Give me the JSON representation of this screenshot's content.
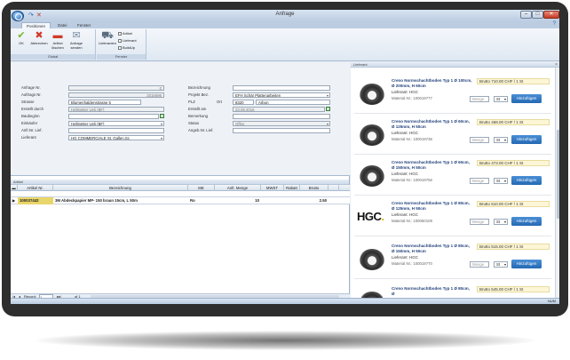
{
  "window": {
    "title": "Anfrage",
    "minimize": "–",
    "maximize": "□",
    "close": "✕"
  },
  "quick_access": {
    "redo": "↷",
    "close_x": "✕"
  },
  "tabs": [
    {
      "label": "Positionen",
      "active": true
    },
    {
      "label": "Datei"
    },
    {
      "label": "Fenster"
    }
  ],
  "ribbon": {
    "groups": [
      {
        "label": "Global"
      },
      {
        "label": "Fenster"
      }
    ],
    "buttons": {
      "ok": "OK",
      "cancel": "Abbrechen",
      "delete": "Artikel löschen",
      "send": "Anfrage senden",
      "supplier": "Lieferanten"
    },
    "options": {
      "artikel": "Artikel",
      "lieferant": "Lieferant",
      "buildup": "BuildUp"
    }
  },
  "form": {
    "left": [
      {
        "label": "Anfrage Nr.",
        "value": "0",
        "disabled": true
      },
      {
        "label": "Auftrags Nr.",
        "value": "2016696",
        "disabled": true
      },
      {
        "label": "Strasse",
        "value": "Blumenhaldenstrasse 5"
      },
      {
        "label": "Erstellt durch",
        "value": "Hellstetter Ueli (BF)",
        "disabled": true
      },
      {
        "label": "Baubeginn",
        "value": ""
      },
      {
        "label": "Einkäufer",
        "value": "Hellstetter Ueli (BF)"
      },
      {
        "label": "Anfr.Nr. Lief.",
        "value": ""
      },
      {
        "label": "Lieferant",
        "value": "HG COMMERCIALE St. Gallen,Sc"
      }
    ],
    "right": [
      {
        "label": "Bezeichnung",
        "value": ""
      },
      {
        "label": "Projekt Bez.",
        "value": "EFH Schär Plattenarbeiten",
        "disabled": true
      },
      {
        "label": "PLZ",
        "label2": "Ort",
        "value": "8320",
        "value2": "Arbon"
      },
      {
        "label": "Erstellt am",
        "value": "23.09.2016",
        "disabled": true
      },
      {
        "label": "Bemerkung",
        "value": ""
      },
      {
        "label": "Status",
        "value": "Offen",
        "disabled": true
      },
      {
        "label": "Angeb.Nr. Lief.",
        "value": ""
      }
    ]
  },
  "grid": {
    "section_label": "Artikel",
    "columns": [
      "Artikel Nr.",
      "Bezeichnung",
      "ME",
      "Anfr. Menge",
      "MWST",
      "Rabatt",
      "Brutto"
    ],
    "rows": [
      {
        "artikel_nr": "100037442",
        "bezeichnung": "3M Abdeckpapier MP- 150 braun 15cm, L 50m",
        "me": "Ro",
        "menge": "10",
        "mwst": "",
        "rabatt": "",
        "brutto": "2.50"
      }
    ],
    "nav": {
      "record_label": "Record:",
      "record_value": "1",
      "of": "of 1"
    }
  },
  "lieferant_panel": {
    "title": "Lieferant",
    "products": [
      {
        "title": "Creno Normschachtboden Typ 1 Ø 100cm, Ø 200mm, H 60cm",
        "supplier": "Lieferant: HGC",
        "material": "Material Nr.: 100019777",
        "price": "Brutto 710.00 CHF / 1 St",
        "menge_placeholder": "Menge",
        "unit": "St",
        "add": "Hinzufügen"
      },
      {
        "title": "Creno Normschachtboden Typ 1 Ø 60cm, Ø 125mm, H 50cm",
        "supplier": "Lieferant: HGC",
        "material": "Material Nr.: 100019736",
        "price": "Brutto 468.00 CHF / 1 St",
        "menge_placeholder": "Menge",
        "unit": "St",
        "add": "Hinzufügen"
      },
      {
        "title": "Creno Normschachtboden Typ 1 Ø 60cm, Ø 150mm, H 50cm",
        "supplier": "Lieferant: HGC",
        "material": "Material Nr.: 100019756",
        "price": "Brutto 473.00 CHF / 1 St",
        "menge_placeholder": "Menge",
        "unit": "St",
        "add": "Hinzufügen"
      },
      {
        "title": "Creno Normschachtboden Typ 1 Ø 80cm, Ø 125mm, H 50cm",
        "supplier": "Lieferant: HGC",
        "material": "Material Nr.: 100060109",
        "price": "Brutto 510.00 CHF / 1 St",
        "menge_placeholder": "Menge",
        "unit": "St",
        "add": "Hinzufügen"
      },
      {
        "title": "Creno Normschachtboden Typ 1 Ø 80cm, Ø 150mm, H 50cm",
        "supplier": "Lieferant: HGC",
        "material": "Material Nr.: 100019770",
        "price": "Brutto 515.00 CHF / 1 St",
        "menge_placeholder": "Menge",
        "unit": "St",
        "add": "Hinzufügen"
      },
      {
        "title": "Creno Normschachtboden Typ 1 Ø 80cm, Ø",
        "price": "Brutto 545.00 CHF / 1 St"
      }
    ],
    "logo_text": "HGC"
  },
  "statusbar": {
    "mode": "NUM"
  }
}
